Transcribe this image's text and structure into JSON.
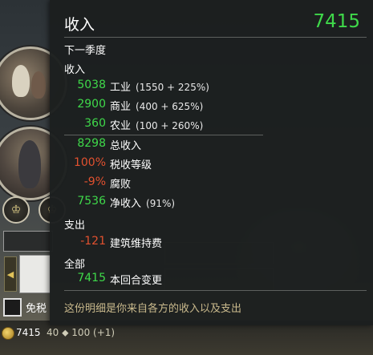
{
  "tooltip": {
    "title": "收入",
    "total": "7415",
    "next_season": "下一季度",
    "income_header": "收入",
    "income_rows": [
      {
        "value": "5038",
        "label": "工业",
        "detail": "(1550 + 225%)"
      },
      {
        "value": "2900",
        "label": "商业",
        "detail": "(400 + 625%)"
      },
      {
        "value": "360",
        "label": "农业",
        "detail": "(100 + 260%)"
      }
    ],
    "summary_rows": [
      {
        "value": "8298",
        "label": "总收入",
        "detail": ""
      },
      {
        "value": "100%",
        "label": "税收等级",
        "detail": ""
      },
      {
        "value": "-9%",
        "label": "腐败",
        "detail": ""
      },
      {
        "value": "7536",
        "label": "净收入",
        "detail": "(91%)"
      }
    ],
    "expense_header": "支出",
    "expense_rows": [
      {
        "value": "-121",
        "label": "建筑维持费"
      }
    ],
    "all_header": "全部",
    "all_rows": [
      {
        "value": "7415",
        "label": "本回合变更"
      }
    ],
    "footnote": "这份明细是你来自各方的收入以及支出"
  },
  "background": {
    "tax_exempt_label": "免税",
    "gold_amount": "7415",
    "bar_extra": "40 ⬥ 100 (+1)"
  },
  "colors": {
    "positive": "#3fd94a",
    "negative": "#e2512f",
    "footnote": "#c9b98c"
  },
  "icons": [
    "coin-icon",
    "settlement-badge-icon",
    "left-arrow-icon"
  ]
}
